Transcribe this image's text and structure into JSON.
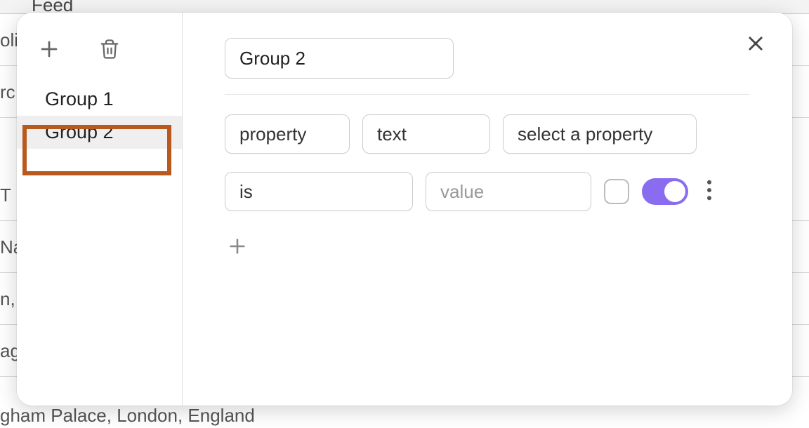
{
  "bg": {
    "feed": "Feed",
    "rows": [
      "oli",
      "rc",
      "T",
      "Na",
      "n,",
      "ag"
    ],
    "bottom": "gham Palace, London, England"
  },
  "sidebar": {
    "groups": [
      "Group 1",
      "Group 2"
    ],
    "active_index": 1
  },
  "main": {
    "name": "Group 2",
    "value_placeholder": "value",
    "chips": {
      "property": "property",
      "text": "text",
      "select": "select a property",
      "op": "is"
    }
  },
  "toggle_on": true
}
